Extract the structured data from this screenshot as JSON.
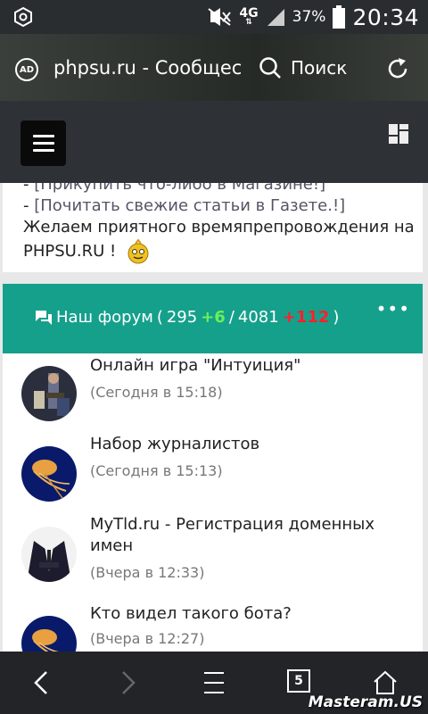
{
  "status_bar": {
    "network": "4G",
    "battery": "37%",
    "time": "20:34"
  },
  "address_bar": {
    "ad_icon": "AD",
    "url": "phpsu.ru - Сообщество",
    "search_label": "Поиск"
  },
  "welcome": {
    "link1": "[Прикупить что-либо в Магазине!]",
    "link2": "[Почитать свежие статьи в Газете.!]",
    "line3": "Желаем приятного времяпрепровождения на",
    "line4": "PHPSU.RU !",
    "dash": "-"
  },
  "forum_bar": {
    "title": "Наш форум",
    "paren_open": "(",
    "topics": "295",
    "topics_new": "+6",
    "separator": "/",
    "posts": "4081",
    "posts_new": "+112",
    "paren_close": ")",
    "more": "•••"
  },
  "topics": [
    {
      "title": "Онлайн игра \"Интуиция\"",
      "time": "(Сегодня в 15:18)",
      "avatar": "avatar-guitarist"
    },
    {
      "title": "Набор журналистов",
      "time": "(Сегодня в 15:13)",
      "avatar": "avatar-jellyfish"
    },
    {
      "title": "MyTld.ru - Регистрация доменных имен",
      "time": "(Вчера в 12:33)",
      "avatar": "avatar-suit"
    },
    {
      "title": "Кто видел такого бота?",
      "time": "(Вчера в 12:27)",
      "avatar": "avatar-jellyfish"
    }
  ],
  "bottom_nav": {
    "tabs_count": "5",
    "watermark": "Masteram.US"
  },
  "colors": {
    "accent": "#15a08c",
    "positive": "#6af05a",
    "negative": "#ff1f2a"
  }
}
